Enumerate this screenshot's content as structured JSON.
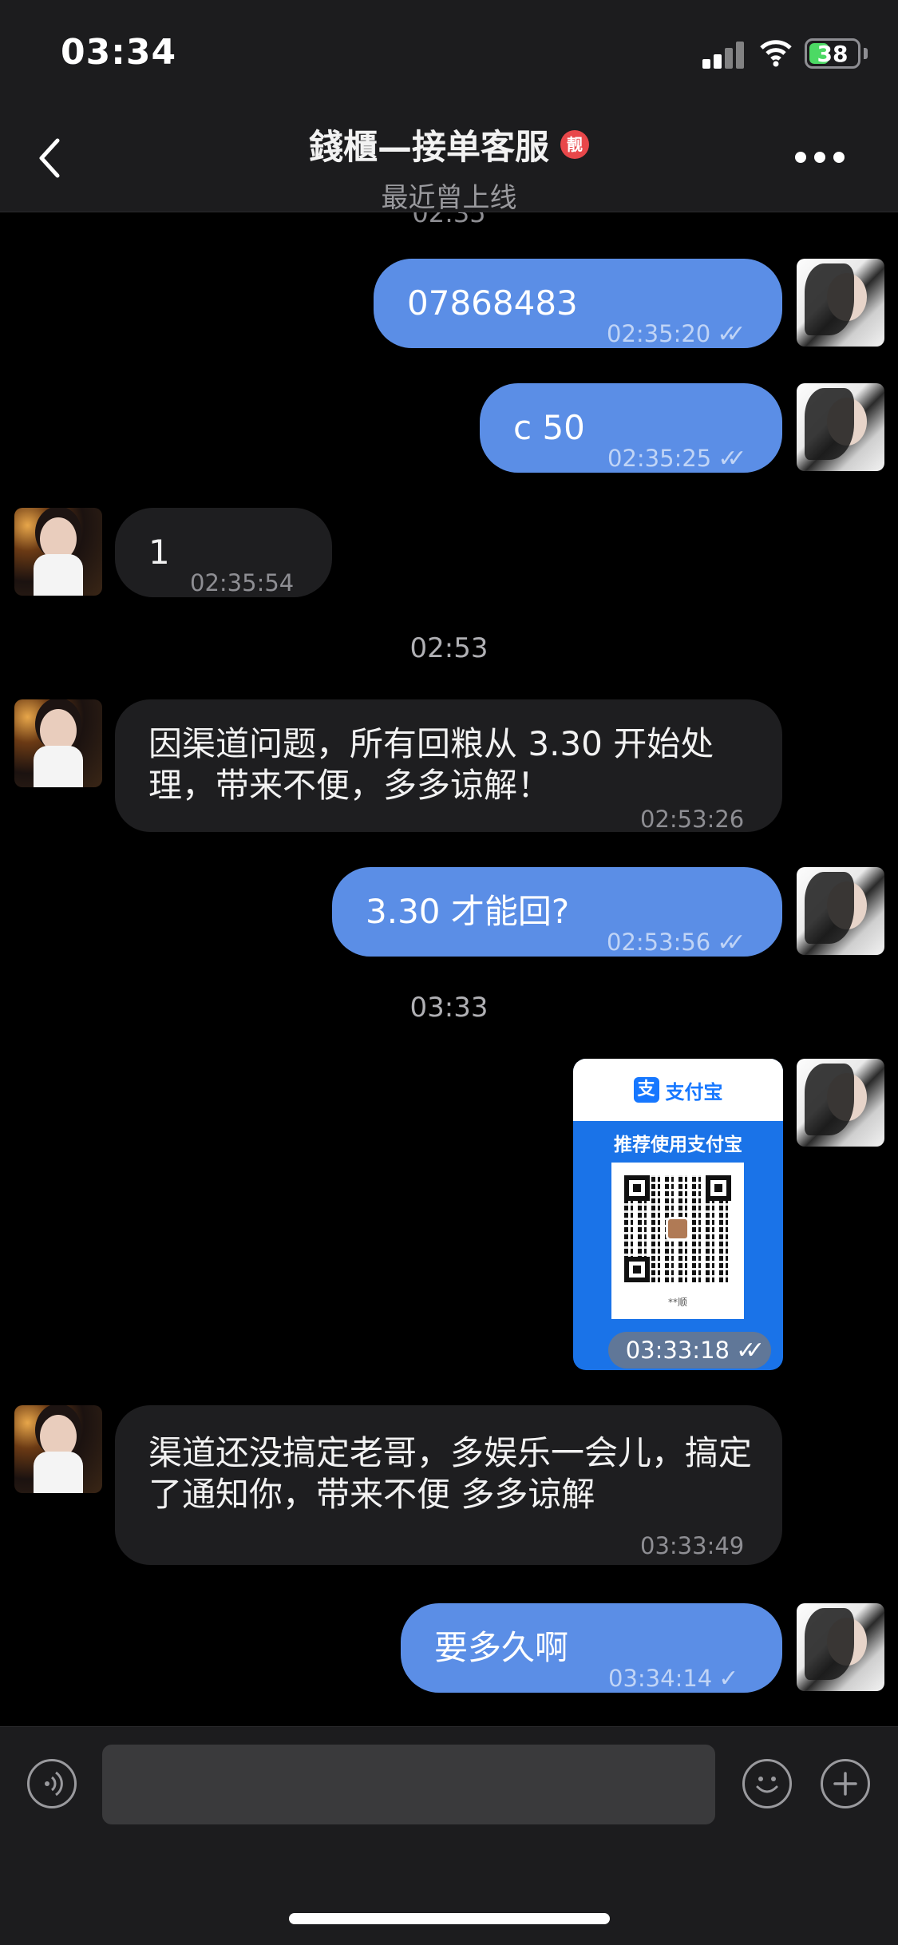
{
  "status_bar": {
    "time": "03:34",
    "battery": "38"
  },
  "header": {
    "title": "錢櫃—接单客服",
    "badge": "靓",
    "subtitle": "最近曾上线"
  },
  "chat": {
    "cut_timestamp": "02:35",
    "messages": [
      {
        "text": "07868483",
        "time": "02:35:20",
        "tick": "✓✓"
      },
      {
        "text": "c 50",
        "time": "02:35:25",
        "tick": "✓✓"
      },
      {
        "text": "1",
        "time": "02:35:54"
      },
      {
        "text": "因渠道问题，所有回粮从 3.30 开始处理，带来不便，多多谅解！",
        "time": "02:53:26"
      },
      {
        "text": "3.30 才能回?",
        "time": "02:53:56",
        "tick": "✓✓"
      },
      {
        "time": "03:33:18",
        "tick": "✓✓"
      },
      {
        "text": "渠道还没搞定老哥，多娱乐一会儿，搞定了通知你，带来不便  多多谅解",
        "time": "03:33:49"
      },
      {
        "text": "要多久啊",
        "time": "03:34:14",
        "tick": "✓"
      }
    ],
    "dividers": [
      "02:53",
      "03:33"
    ]
  },
  "qr_card": {
    "brand_logo": "支",
    "brand_name": "支付宝",
    "recommend": "推荐使用支付宝",
    "caption": "**顺"
  },
  "input": {
    "placeholder": ""
  },
  "colors": {
    "outgoing_bubble": "#5b8ee6",
    "incoming_bubble": "#1e1e20",
    "background": "#000000",
    "bar": "#1c1c1e"
  }
}
